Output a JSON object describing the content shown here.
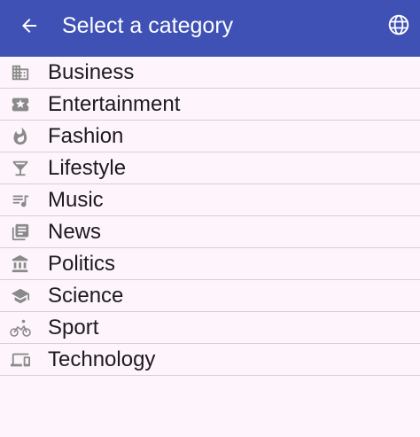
{
  "app_bar": {
    "title": "Select a category",
    "back_icon": "arrow-back-icon",
    "language_icon": "globe-icon",
    "background_color": "#3f51b5"
  },
  "categories": [
    {
      "label": "Business",
      "icon": "building-icon"
    },
    {
      "label": "Entertainment",
      "icon": "ticket-icon"
    },
    {
      "label": "Fashion",
      "icon": "flame-icon"
    },
    {
      "label": "Lifestyle",
      "icon": "cocktail-icon"
    },
    {
      "label": "Music",
      "icon": "music-list-icon"
    },
    {
      "label": "News",
      "icon": "newspaper-icon"
    },
    {
      "label": "Politics",
      "icon": "bank-icon"
    },
    {
      "label": "Science",
      "icon": "school-cap-icon"
    },
    {
      "label": "Sport",
      "icon": "bicycle-icon"
    },
    {
      "label": "Technology",
      "icon": "devices-icon"
    }
  ]
}
